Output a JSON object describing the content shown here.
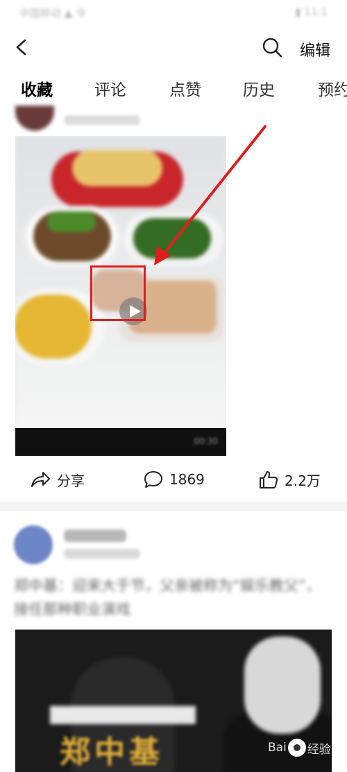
{
  "status_bar": {
    "left": "中国移动 ▲ 令 ",
    "right": "▮ 11:1"
  },
  "topbar": {
    "edit_label": "编辑"
  },
  "tabs": [
    {
      "label": "收藏",
      "active": true
    },
    {
      "label": "评论",
      "active": false
    },
    {
      "label": "点赞",
      "active": false
    },
    {
      "label": "历史",
      "active": false
    },
    {
      "label": "预约",
      "active": false
    }
  ],
  "post1": {
    "video_duration": "00:30",
    "actions": {
      "share_label": "分享",
      "comment_count": "1869",
      "like_count": "2.2万"
    }
  },
  "post2": {
    "headline": "郑中基：迎来大于节，父亲被称为“娱乐教父”，接任那种职业演戏",
    "overlay_title": "郑中基"
  },
  "watermark": {
    "text": "Bai",
    "text2": "经验"
  },
  "colors": {
    "annotation_red": "#e21d1d",
    "background": "#f3f3f3",
    "card": "#ffffff"
  }
}
